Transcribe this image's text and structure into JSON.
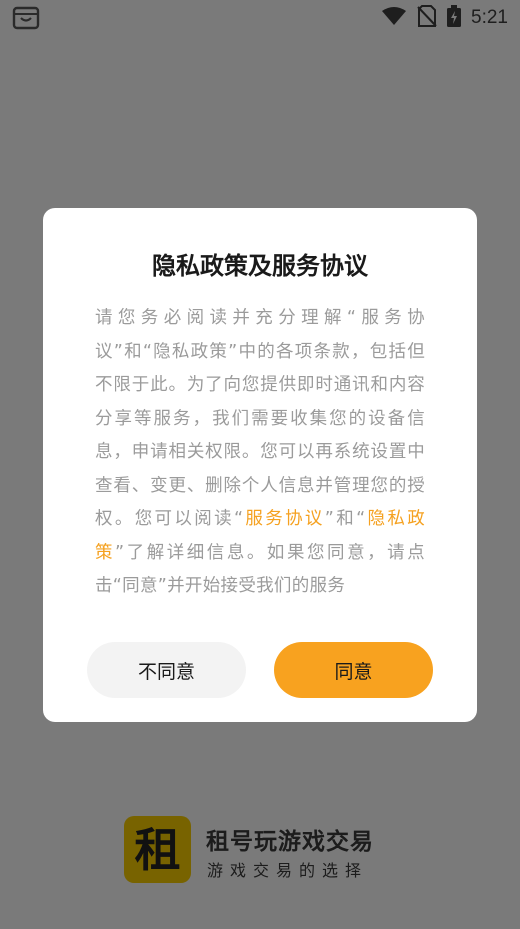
{
  "status_bar": {
    "time": "5:21"
  },
  "dialog": {
    "title": "隐私政策及服务协议",
    "body_1": "请您务必阅读并充分理解“服务协议”和“隐私政策”中的各项条款，包括但不限于此。为了向您提供即时通讯和内容分享等服务，我们需要收集您的设备信息，申请相关权限。您可以再系统设置中查看、变更、删除个人信息并管理您的授权。您可以阅读“",
    "link_service": "服务协议",
    "body_2": "”和“",
    "link_privacy": "隐私政策",
    "body_3": "”了解详细信息。如果您同意，请点击“同意”并开始接受我们的服务",
    "cancel_label": "不同意",
    "agree_label": "同意"
  },
  "brand": {
    "logo_char": "租",
    "name": "租号玩游戏交易",
    "slogan": "游戏交易的选择"
  },
  "colors": {
    "accent": "#f8a21f",
    "link": "#f5a120",
    "overlay": "#7a7a7a"
  }
}
